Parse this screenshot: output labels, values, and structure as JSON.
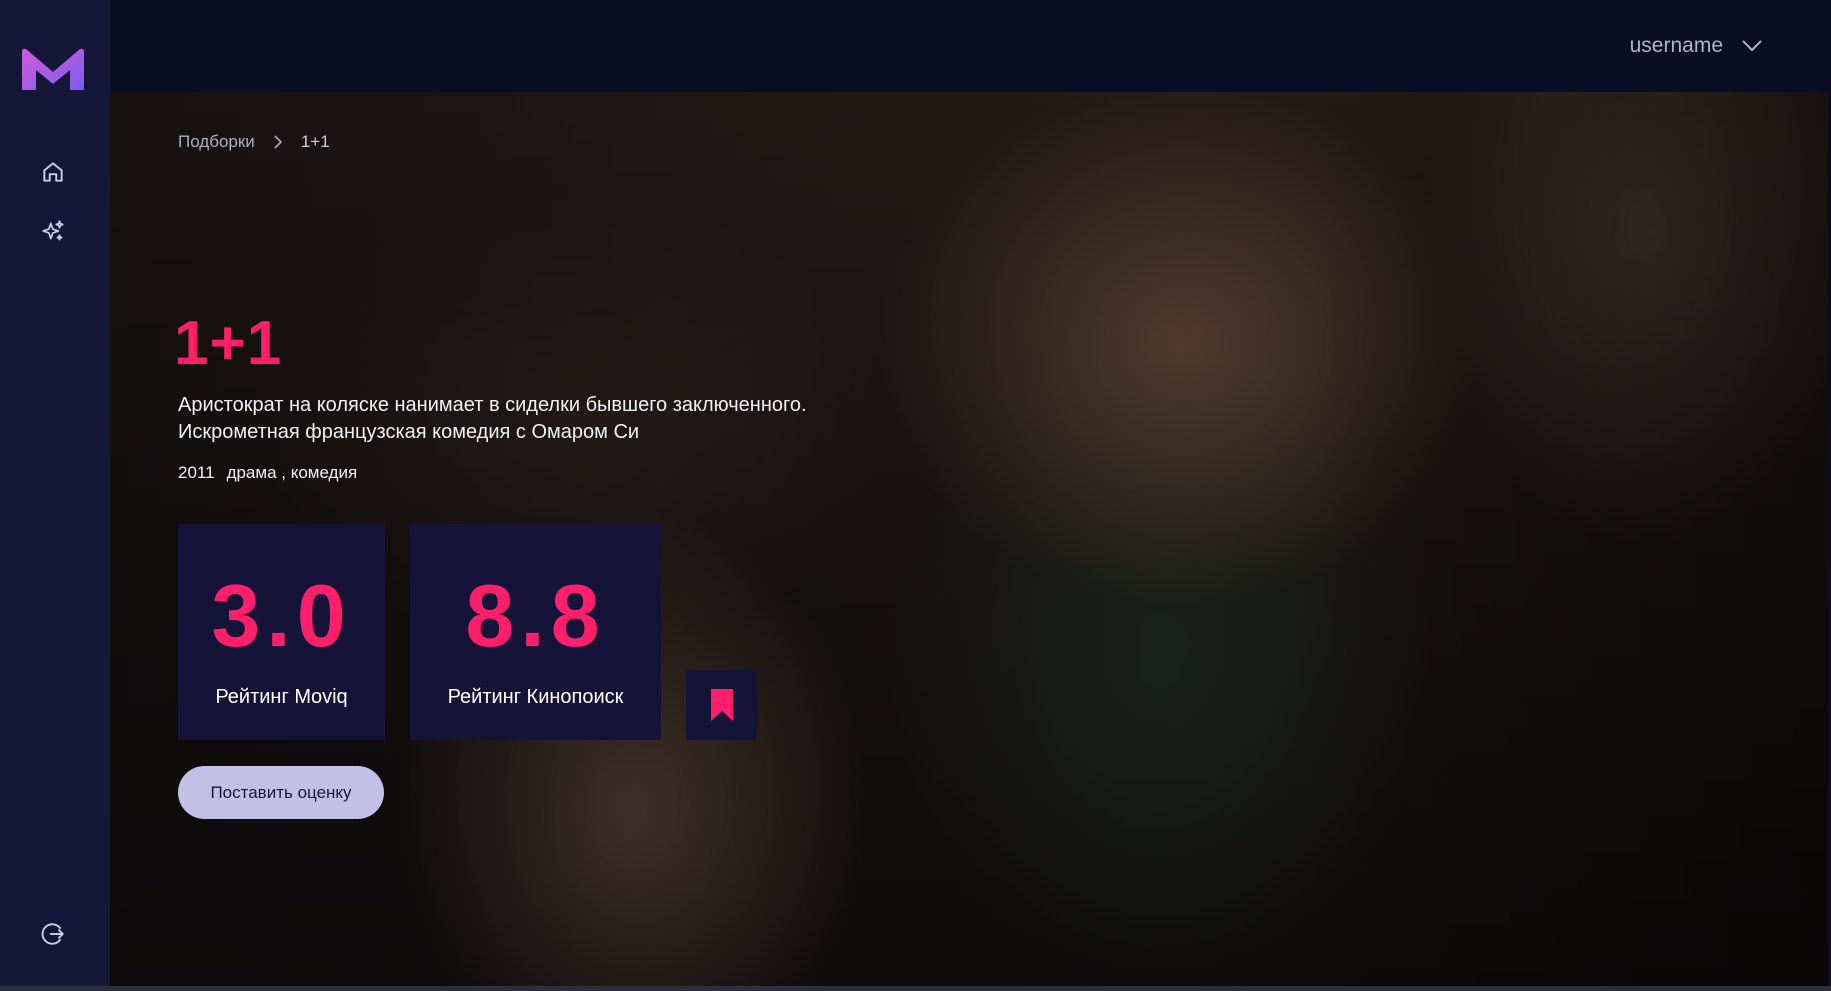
{
  "app": {
    "logo_icon": "moviq-logo-icon",
    "accent_color": "#ff1f6b",
    "sidebar_color": "#141738",
    "topbar_color": "#0b0d24"
  },
  "sidebar": {
    "items": [
      {
        "icon": "home-icon"
      },
      {
        "icon": "sparkles-icon"
      }
    ],
    "logout_icon": "logout-icon"
  },
  "header": {
    "username": "username",
    "dropdown_icon": "chevron-down-icon"
  },
  "breadcrumb": {
    "parent": "Подборки",
    "current": "1+1"
  },
  "movie": {
    "title": "1+1",
    "description_line1": "Аристократ на коляске нанимает в сиделки бывшего заключенного.",
    "description_line2": "Искрометная французская комедия с Омаром Си",
    "year": "2011",
    "genres": "драма , комедия"
  },
  "ratings": [
    {
      "value": "3.0",
      "label": "Рейтинг Moviq"
    },
    {
      "value": "8.8",
      "label": "Рейтинг Кинопоиск"
    }
  ],
  "actions": {
    "bookmark_icon": "bookmark-icon",
    "rate_label": "Поставить оценку"
  }
}
